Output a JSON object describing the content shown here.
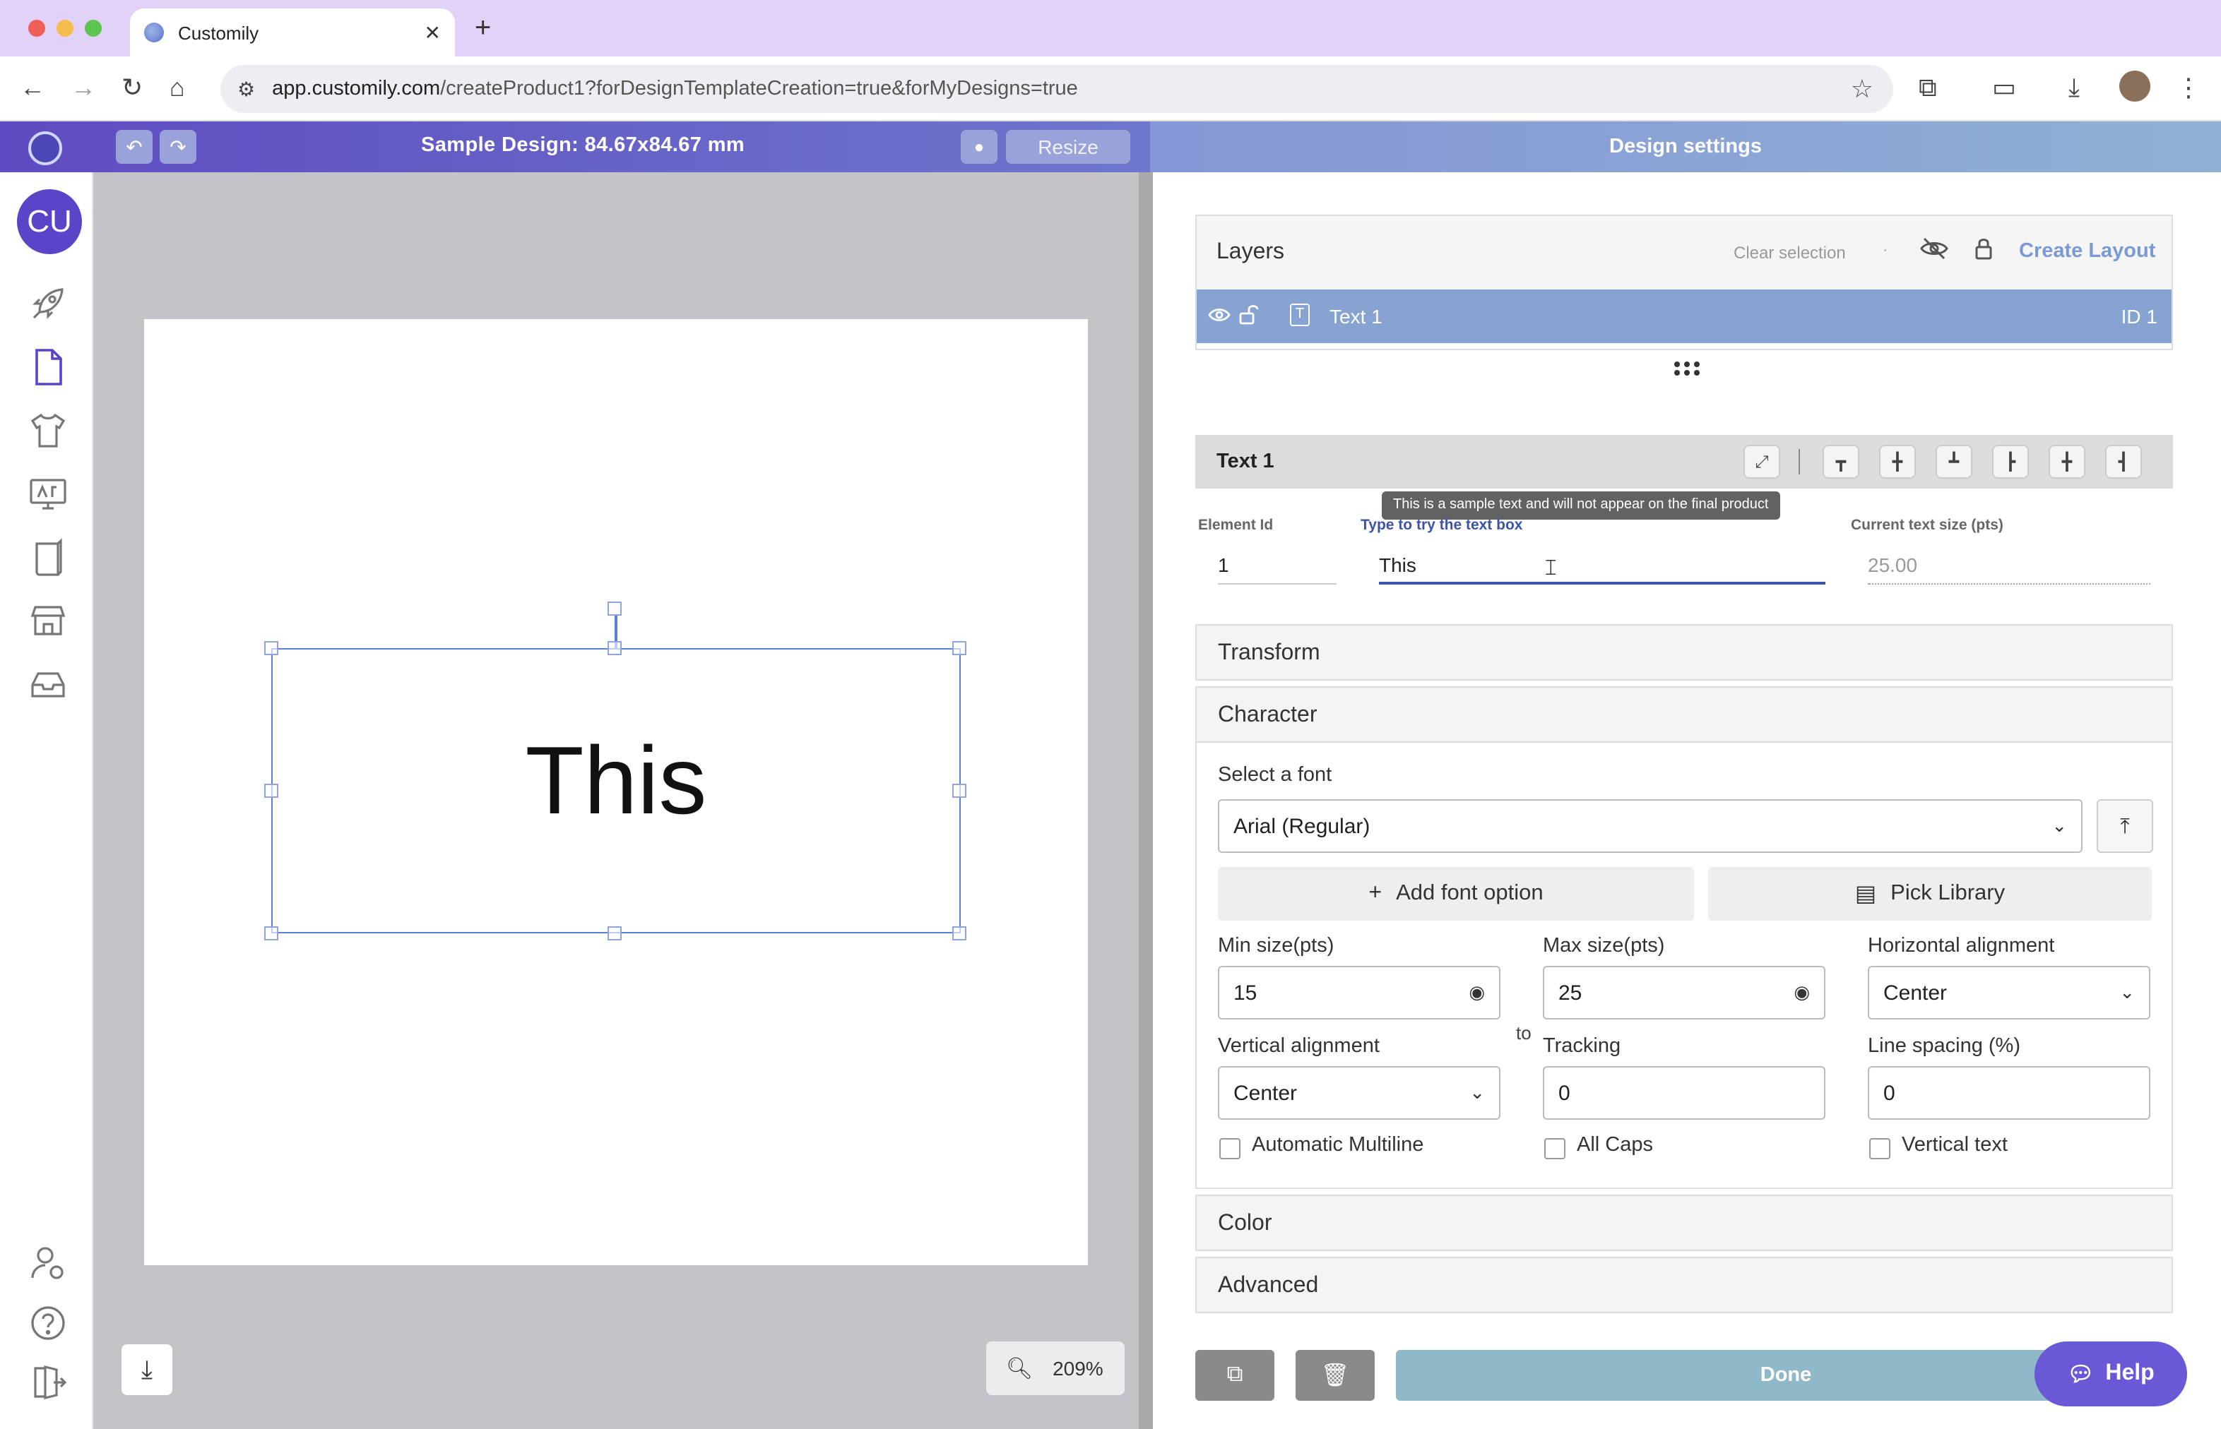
{
  "browser": {
    "tab_title": "Customily",
    "tab_close": "✕",
    "new_tab": "+",
    "url_host": "app.customily.com",
    "url_path": "/createProduct1?forDesignTemplateCreation=true&forMyDesigns=true"
  },
  "topbar": {
    "design_title": "Sample Design: 84.67x84.67 mm",
    "resize_label": "Resize",
    "panel_title": "Design settings"
  },
  "rail": {
    "avatar_initials": "CU"
  },
  "canvas": {
    "text": "This",
    "zoom": "209%"
  },
  "layers": {
    "title": "Layers",
    "clear_selection": "Clear selection",
    "create_layout": "Create Layout",
    "items": [
      {
        "name": "Text 1",
        "id_label": "ID 1"
      }
    ]
  },
  "element": {
    "title": "Text 1",
    "tooltip": "This is a sample text and will not appear on the final product",
    "element_id_label": "Element Id",
    "element_id_value": "1",
    "try_text_label": "Type to try the text box",
    "try_text_value": "This",
    "current_size_label": "Current text size (pts)",
    "current_size_value": "25.00"
  },
  "sections": {
    "transform": "Transform",
    "character": "Character",
    "color": "Color",
    "advanced": "Advanced"
  },
  "character": {
    "select_font_label": "Select a font",
    "font_value": "Arial (Regular)",
    "add_font_option": "Add font option",
    "pick_library": "Pick Library",
    "min_size_label": "Min size(pts)",
    "min_size_value": "15",
    "to_label": "to",
    "max_size_label": "Max size(pts)",
    "max_size_value": "25",
    "h_align_label": "Horizontal alignment",
    "h_align_value": "Center",
    "v_align_label": "Vertical alignment",
    "v_align_value": "Center",
    "tracking_label": "Tracking",
    "tracking_value": "0",
    "line_spacing_label": "Line spacing (%)",
    "line_spacing_value": "0",
    "auto_multiline": "Automatic Multiline",
    "all_caps": "All Caps",
    "vertical_text": "Vertical text",
    "auto_multiline_checked": false,
    "all_caps_checked": false,
    "vertical_text_checked": false
  },
  "footer": {
    "done": "Done",
    "help": "Help"
  },
  "colors": {
    "brand_purple": "#5b44c7",
    "selected_layer": "#87a3d1",
    "done_button": "#8fb8c8",
    "help_button": "#6a59d6"
  }
}
